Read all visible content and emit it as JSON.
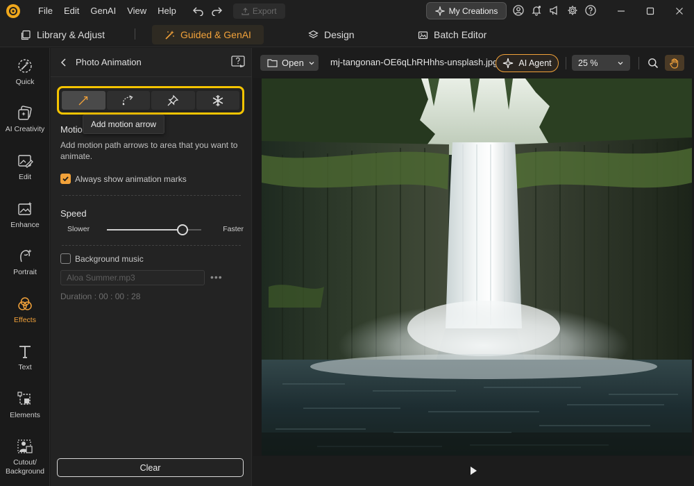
{
  "titlebar": {
    "menu": [
      "File",
      "Edit",
      "GenAI",
      "View",
      "Help"
    ],
    "export_label": "Export",
    "my_creations_label": "My Creations"
  },
  "modes": {
    "library": "Library & Adjust",
    "guided": "Guided & GenAI",
    "design": "Design",
    "batch": "Batch Editor"
  },
  "rail": {
    "items": [
      {
        "label": "Quick",
        "icon": "magic-wand-icon"
      },
      {
        "label": "AI Creativity",
        "icon": "ai-creativity-icon"
      },
      {
        "label": "Edit",
        "icon": "edit-image-icon"
      },
      {
        "label": "Enhance",
        "icon": "enhance-icon"
      },
      {
        "label": "Portrait",
        "icon": "portrait-icon"
      },
      {
        "label": "Effects",
        "icon": "effects-icon"
      },
      {
        "label": "Text",
        "icon": "text-icon"
      },
      {
        "label": "Elements",
        "icon": "elements-icon"
      },
      {
        "label": "Cutout/\nBackground",
        "icon": "cutout-icon"
      }
    ],
    "active": "Effects"
  },
  "panel": {
    "title": "Photo Animation",
    "tooltip": "Add motion arrow",
    "section_title": "Motio",
    "description": "Add motion path arrows to area that you want to animate.",
    "always_show_label": "Always show animation marks",
    "always_show_checked": true,
    "speed_title": "Speed",
    "speed_min_label": "Slower",
    "speed_max_label": "Faster",
    "speed_value": 0.8,
    "bg_music_label": "Background music",
    "bg_music_checked": false,
    "music_file": "Aloa Summer.mp3",
    "more_label": "•••",
    "duration": "Duration : 00 : 00 : 28",
    "clear_label": "Clear"
  },
  "canvas": {
    "open_label": "Open",
    "filename": "mj-tangonan-OE6qLhRHhhs-unsplash.jpg",
    "ai_agent_label": "AI Agent",
    "zoom": "25 %"
  },
  "colors": {
    "accent": "#f2a23a",
    "highlight": "#f5c400"
  }
}
